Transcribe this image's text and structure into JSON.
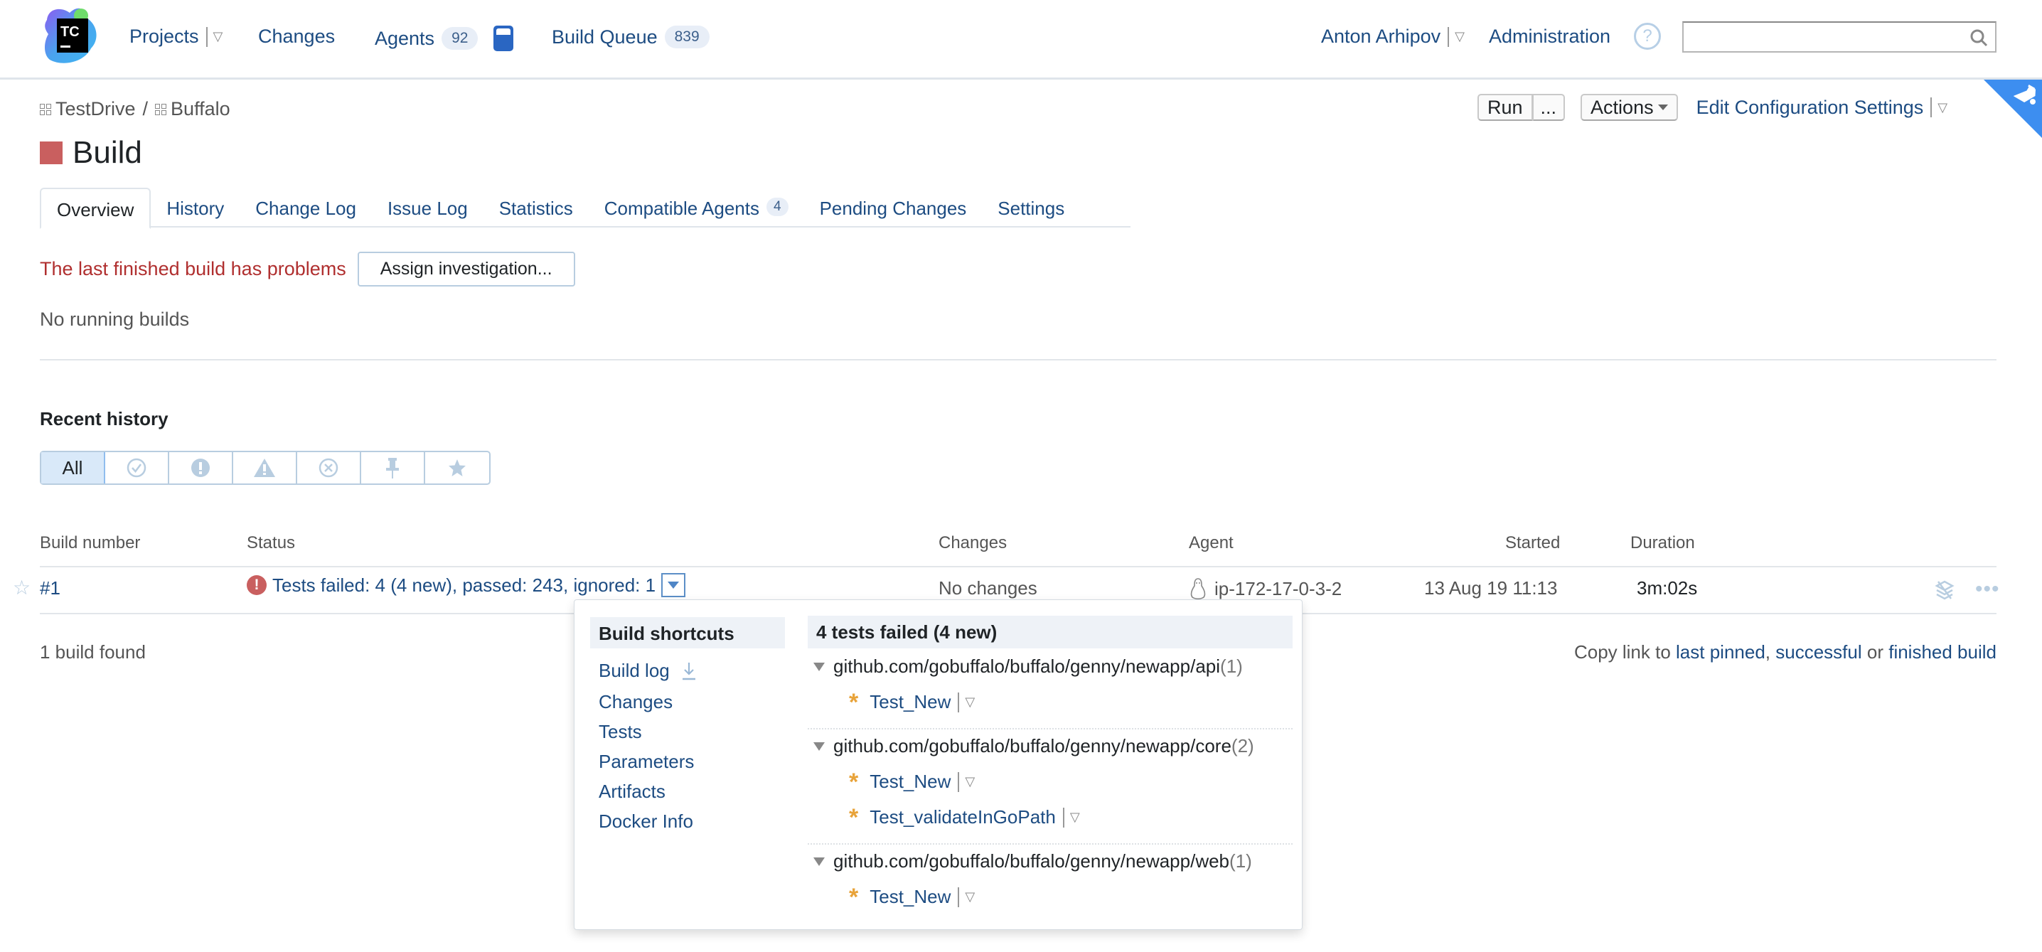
{
  "header": {
    "logo_text": "TC",
    "nav": {
      "projects": "Projects",
      "changes": "Changes",
      "agents": "Agents",
      "agents_count": "92",
      "build_queue": "Build Queue",
      "build_queue_count": "839"
    },
    "user": "Anton Arhipov",
    "administration": "Administration",
    "help_icon": "?",
    "search": {
      "value": "",
      "placeholder": ""
    }
  },
  "breadcrumb": [
    "TestDrive",
    "Buffalo"
  ],
  "breadcrumb_sep": "/",
  "page_title": "Build",
  "status_color": "#c95f5f",
  "actions": {
    "run": "Run",
    "run_more": "...",
    "actions": "Actions",
    "edit_config": "Edit Configuration Settings"
  },
  "tabs": [
    {
      "label": "Overview",
      "active": true
    },
    {
      "label": "History"
    },
    {
      "label": "Change Log"
    },
    {
      "label": "Issue Log"
    },
    {
      "label": "Statistics"
    },
    {
      "label": "Compatible Agents",
      "count": "4"
    },
    {
      "label": "Pending Changes"
    },
    {
      "label": "Settings"
    }
  ],
  "problem": {
    "message": "The last finished build has problems",
    "assign_button": "Assign investigation..."
  },
  "no_running": "No running builds",
  "recent_history": {
    "title": "Recent history",
    "filters": [
      {
        "label": "All",
        "icon": "all",
        "active": true
      },
      {
        "label": "",
        "icon": "check-circle-icon"
      },
      {
        "label": "",
        "icon": "exclamation-icon"
      },
      {
        "label": "",
        "icon": "warning-icon"
      },
      {
        "label": "",
        "icon": "cancel-circle-icon"
      },
      {
        "label": "",
        "icon": "pin-icon"
      },
      {
        "label": "",
        "icon": "star-icon"
      }
    ],
    "filter_glyphs": [
      "All",
      "✓",
      "!",
      "⚠",
      "✕",
      "📌",
      "★"
    ]
  },
  "table": {
    "headers": {
      "build_number": "Build number",
      "status": "Status",
      "changes": "Changes",
      "agent": "Agent",
      "started": "Started",
      "duration": "Duration"
    },
    "rows": [
      {
        "number": "#1",
        "status": "Tests failed: 4 (4 new), passed: 243, ignored: 1",
        "changes": "No changes",
        "agent": "ip-172-17-0-3-2",
        "started": "13 Aug 19 11:13",
        "duration": "3m:02s"
      }
    ],
    "found": "1 build found",
    "copy_link": {
      "prefix": "Copy link to ",
      "last_pinned": "last pinned",
      "comma": ", ",
      "successful": "successful",
      "or": " or ",
      "finished": "finished build"
    }
  },
  "popup": {
    "shortcuts_title": "Build shortcuts",
    "shortcuts": [
      "Build log",
      "Changes",
      "Tests",
      "Parameters",
      "Artifacts",
      "Docker Info"
    ],
    "tests_title": "4 tests failed (4 new)",
    "packages": [
      {
        "name": "github.com/gobuffalo/buffalo/genny/newapp/api",
        "count": "(1)",
        "tests": [
          "Test_New"
        ]
      },
      {
        "name": "github.com/gobuffalo/buffalo/genny/newapp/core",
        "count": "(2)",
        "tests": [
          "Test_New",
          "Test_validateInGoPath"
        ]
      },
      {
        "name": "github.com/gobuffalo/buffalo/genny/newapp/web",
        "count": "(1)",
        "tests": [
          "Test_New"
        ]
      }
    ]
  }
}
